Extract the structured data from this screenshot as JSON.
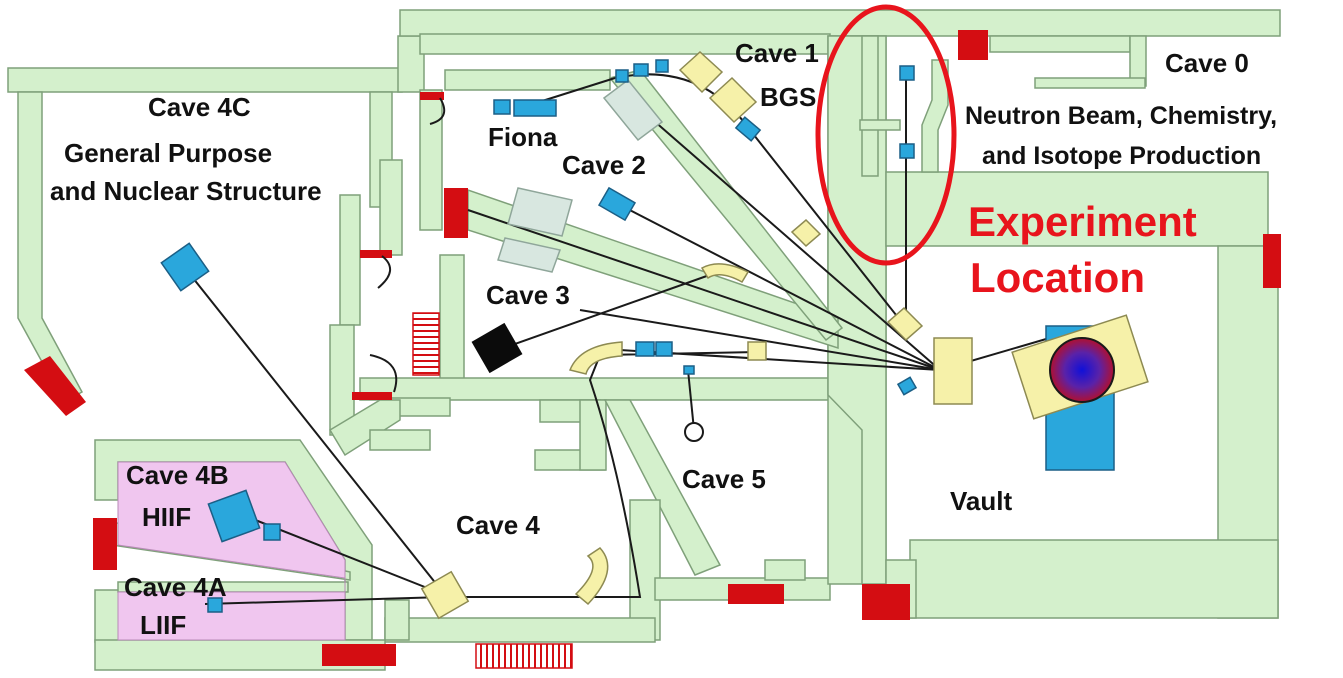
{
  "labels": {
    "cave_4c": "Cave 4C",
    "cave_4c_desc_1": "General Purpose",
    "cave_4c_desc_2": "and Nuclear Structure",
    "fiona": "Fiona",
    "cave_1": "Cave 1",
    "bgs": "BGS",
    "cave_2": "Cave 2",
    "cave_3": "Cave 3",
    "cave_0": "Cave 0",
    "cave_0_desc_1": "Neutron Beam, Chemistry,",
    "cave_0_desc_2": "and Isotope Production",
    "experiment_1": "Experiment",
    "experiment_2": "Location",
    "cave_4b": "Cave 4B",
    "hiif": "HIIF",
    "cave_4a": "Cave 4A",
    "liif": "LIIF",
    "cave_4": "Cave 4",
    "cave_5": "Cave 5",
    "vault": "Vault"
  },
  "colors": {
    "wall_fill": "#d4f0cc",
    "door_red": "#d40d12",
    "highlight_red": "#e8141c",
    "beamline_blue": "#2aa7dc",
    "magnet_yellow": "#f6f1a9",
    "pink_area": "#f0c6ef",
    "source_blue": "#1024c8"
  }
}
